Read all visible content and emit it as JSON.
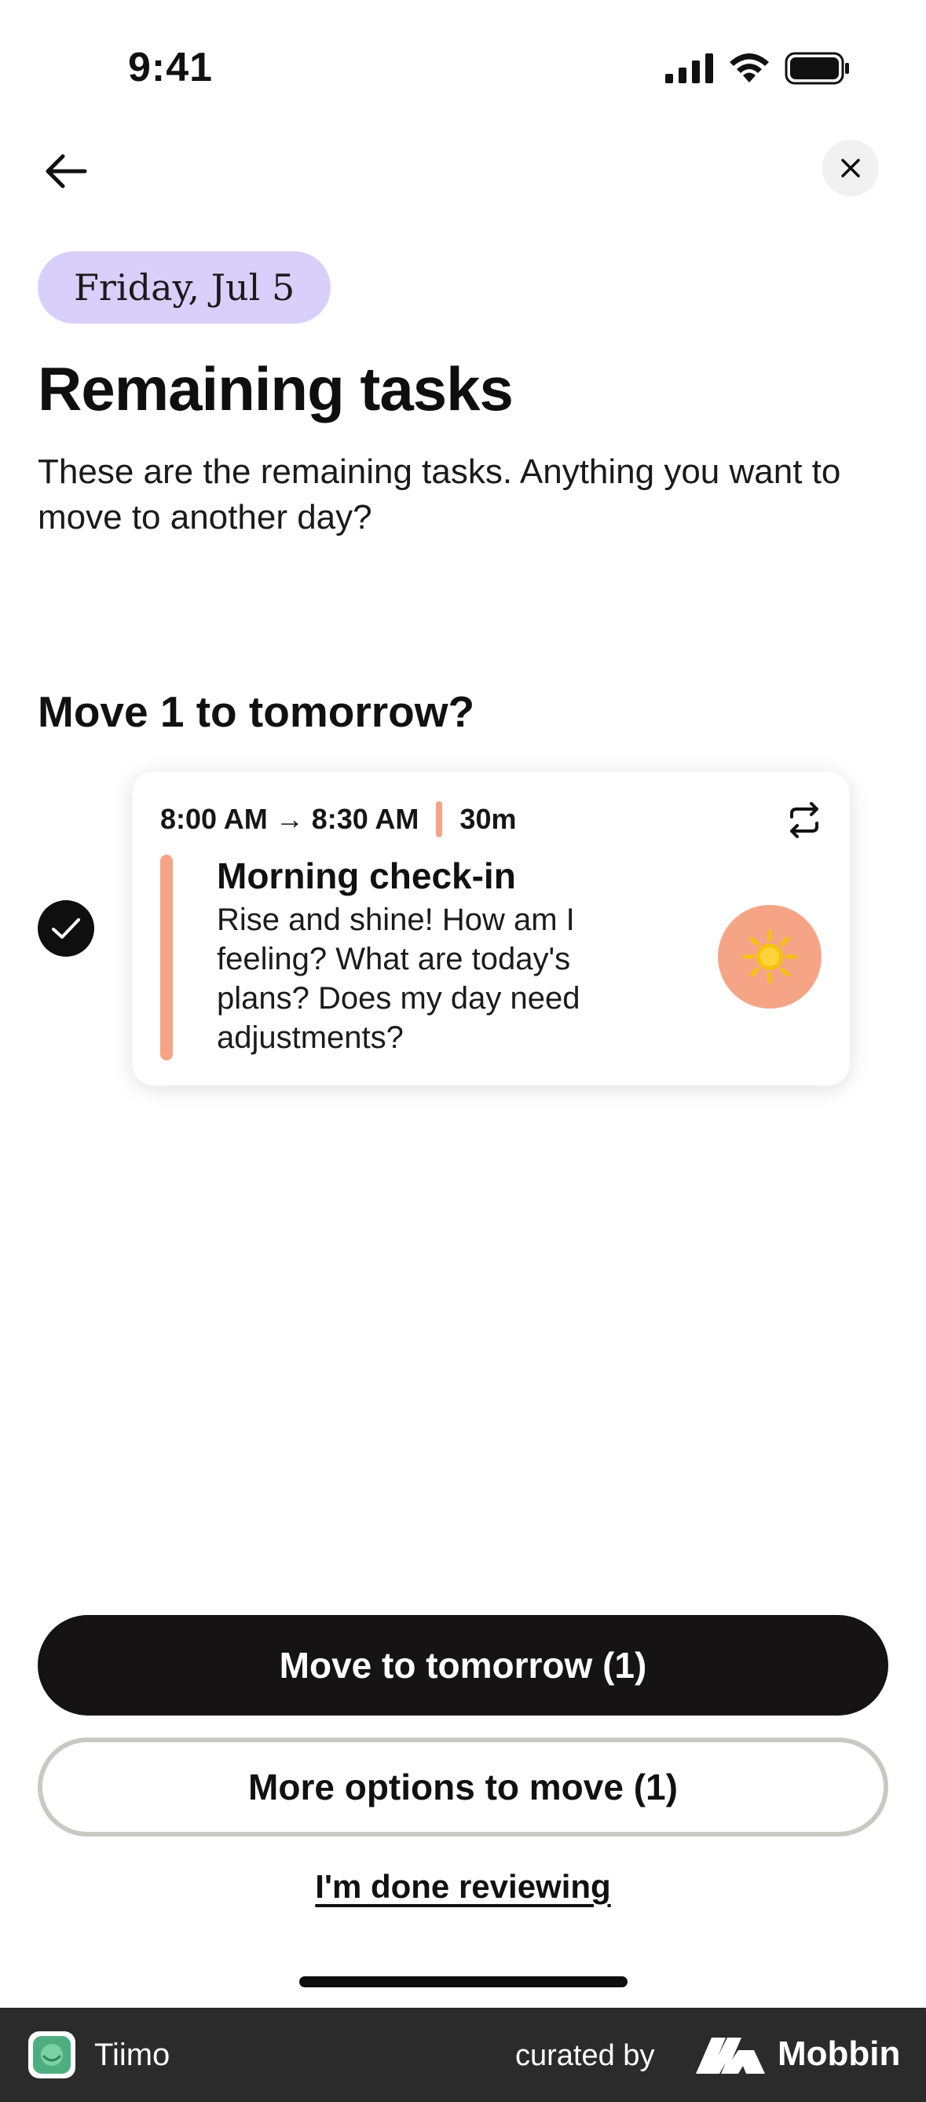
{
  "status_bar": {
    "time": "9:41"
  },
  "header": {
    "date_chip": "Friday, Jul 5"
  },
  "main": {
    "title": "Remaining tasks",
    "subtitle": "These are the remaining tasks. Anything you want to move to another day?",
    "section_heading": "Move 1 to tomorrow?",
    "task": {
      "time_range": "8:00 AM → 8:30 AM",
      "duration": "30m",
      "title": "Morning check-in",
      "description": "Rise and shine! How am I feeling? What are today's plans? Does my day need adjustments?",
      "emoji": "☀️",
      "selected": true
    }
  },
  "actions": {
    "primary_label": "Move to tomorrow (1)",
    "secondary_label": "More options to move (1)",
    "done_link": "I'm done reviewing"
  },
  "footer": {
    "app_name": "Tiimo",
    "curated_by": "curated by",
    "brand": "Mobbin"
  },
  "colors": {
    "chip_bg": "#d9cffb",
    "accent": "#f5a586",
    "primary_button": "#151313",
    "secondary_border": "#c9c9c4",
    "footer_bg": "#2b2b2b"
  },
  "icons": [
    "back-arrow-icon",
    "close-icon",
    "cellular-signal-icon",
    "wifi-icon",
    "battery-icon",
    "checkmark-icon",
    "repeat-icon",
    "sun-icon",
    "tiimo-app-icon",
    "mobbin-logo-icon"
  ]
}
